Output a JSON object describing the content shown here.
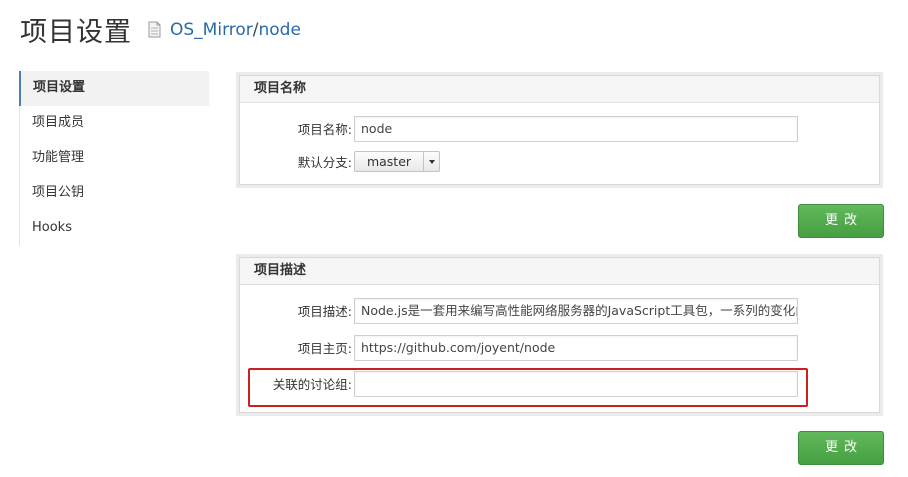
{
  "header": {
    "title": "项目设置",
    "repo_owner": "OS_Mirror",
    "repo_separator": "/",
    "repo_name": "node"
  },
  "sidebar": {
    "items": [
      {
        "label": "项目设置",
        "active": true
      },
      {
        "label": "项目成员",
        "active": false
      },
      {
        "label": "功能管理",
        "active": false
      },
      {
        "label": "项目公钥",
        "active": false
      },
      {
        "label": "Hooks",
        "active": false
      }
    ]
  },
  "name_panel": {
    "heading": "项目名称",
    "name_label": "项目名称:",
    "name_value": "node",
    "branch_label": "默认分支:",
    "branch_value": "master",
    "submit_label": "更改"
  },
  "desc_panel": {
    "heading": "项目描述",
    "desc_label": "项目描述:",
    "desc_value": "Node.js是一套用来编写高性能网络服务器的JavaScript工具包，一系列的变化由此",
    "homepage_label": "项目主页:",
    "homepage_value": "https://github.com/joyent/node",
    "group_label": "关联的讨论组:",
    "group_value": "",
    "submit_label": "更改"
  },
  "colors": {
    "link": "#2a6aa8",
    "button_green": "#4fa94a",
    "highlight_red": "#cc1f1f",
    "active_marker": "#4a7fb5"
  },
  "icons": {
    "repo": "document-icon",
    "dropdown": "caret-down-icon"
  }
}
